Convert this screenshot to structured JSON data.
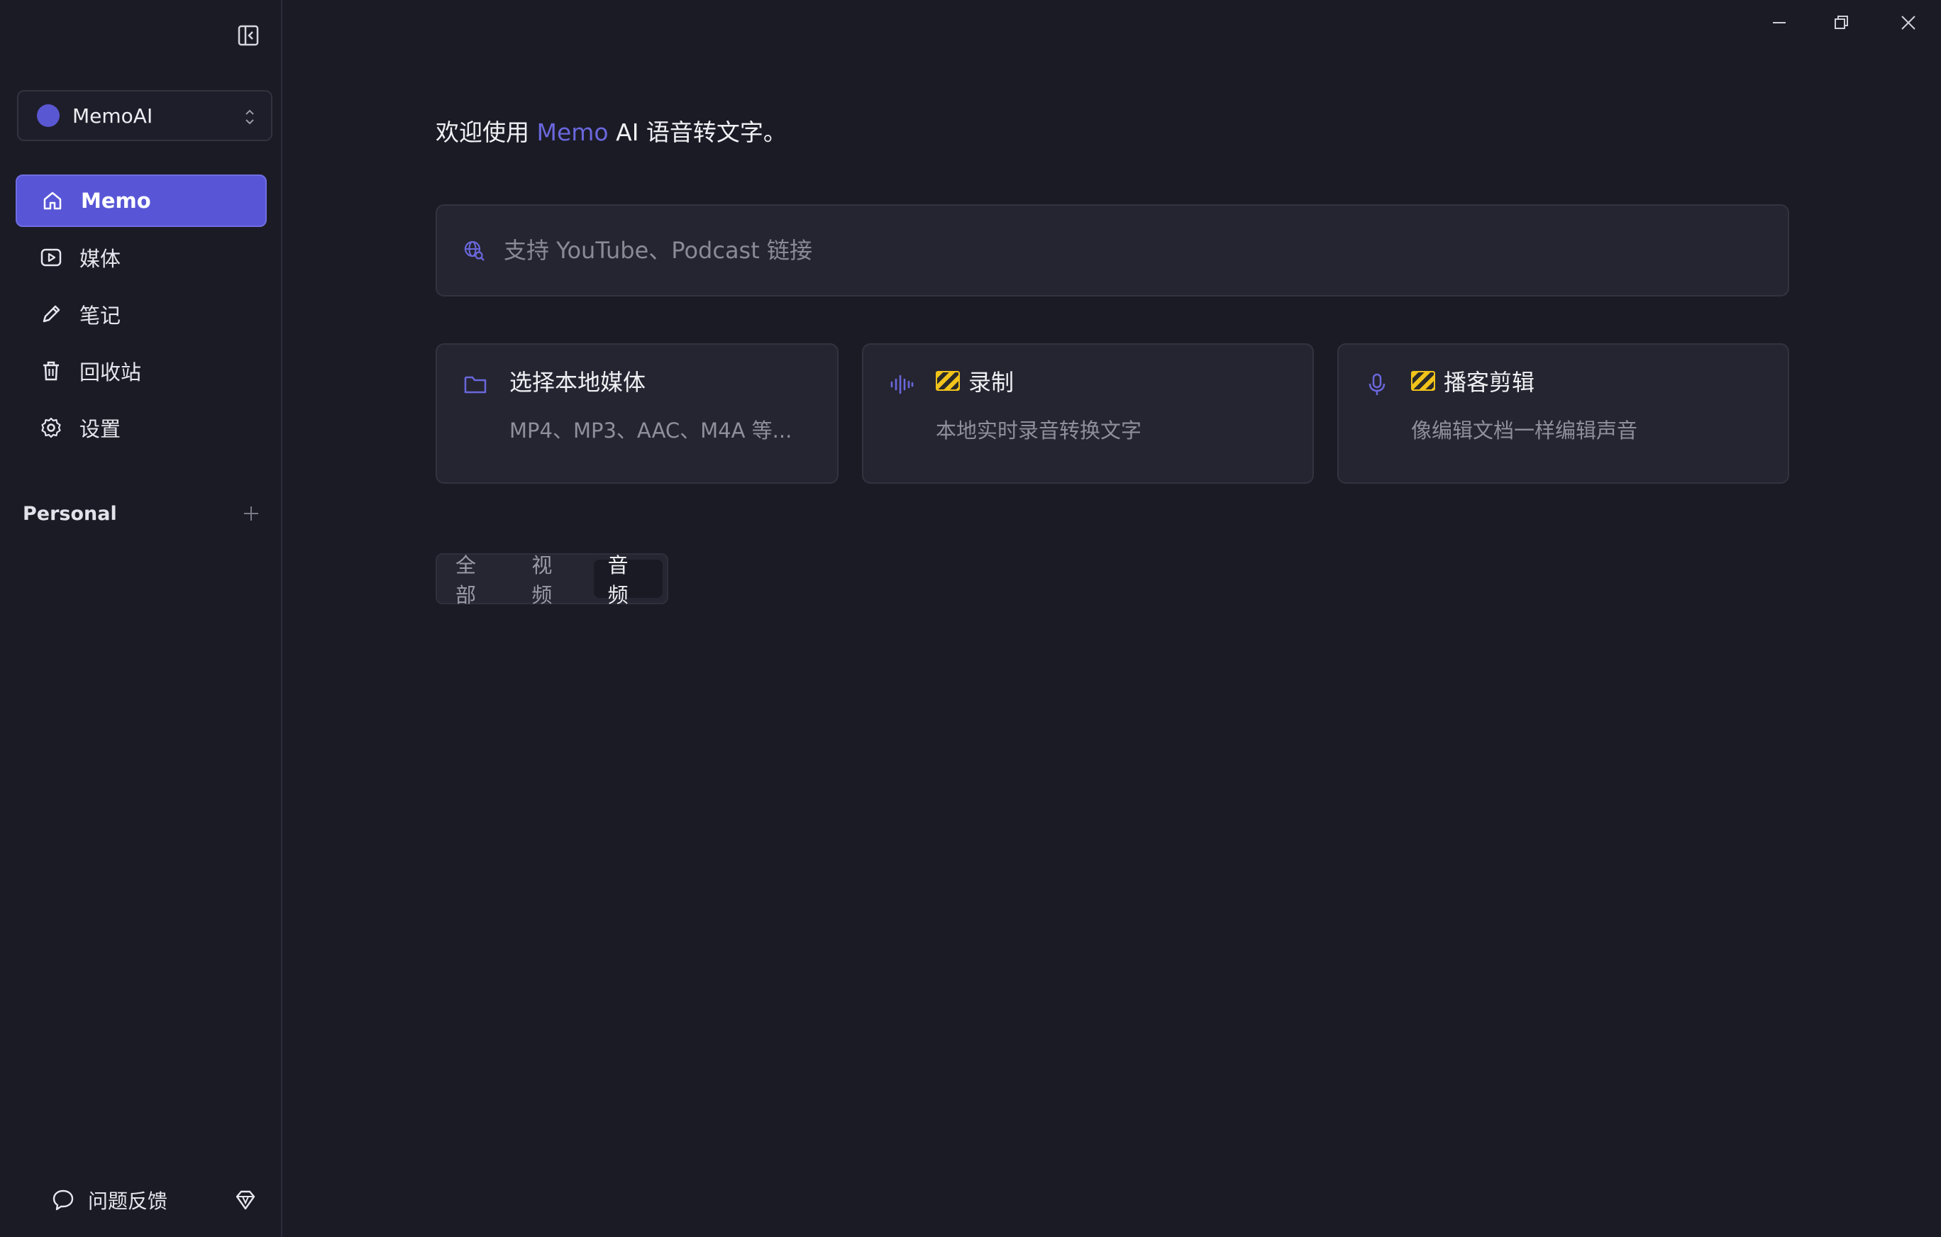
{
  "sidebar": {
    "workspace": {
      "name": "MemoAI",
      "color": "#5a57d3"
    },
    "items": [
      {
        "label": "Memo",
        "icon": "home-icon",
        "active": true
      },
      {
        "label": "媒体",
        "icon": "play-square-icon"
      },
      {
        "label": "笔记",
        "icon": "pencil-icon"
      },
      {
        "label": "回收站",
        "icon": "trash-icon"
      },
      {
        "label": "设置",
        "icon": "gear-icon"
      }
    ],
    "section": {
      "title": "Personal"
    },
    "feedback_label": "问题反馈"
  },
  "main": {
    "welcome": {
      "prefix": "欢迎使用 ",
      "brand": "Memo",
      "suffix": " AI 语音转文字。"
    },
    "url_input": {
      "placeholder": "支持 YouTube、Podcast 链接",
      "value": ""
    },
    "cards": [
      {
        "title": "选择本地媒体",
        "subtitle": "MP4、MP3、AAC、M4A 等...",
        "icon": "folder-icon"
      },
      {
        "title": "录制",
        "subtitle": "本地实时录音转换文字",
        "icon": "waveform-icon",
        "badge": "construction-barrier-icon"
      },
      {
        "title": "播客剪辑",
        "subtitle": "像编辑文档一样编辑声音",
        "icon": "microphone-icon",
        "badge": "construction-barrier-icon"
      }
    ],
    "tabs": [
      {
        "label": "全部"
      },
      {
        "label": "视频"
      },
      {
        "label": "音频",
        "active": true
      }
    ]
  },
  "colors": {
    "accent": "#5856d6",
    "background": "#1b1b26",
    "card": "#252531"
  }
}
